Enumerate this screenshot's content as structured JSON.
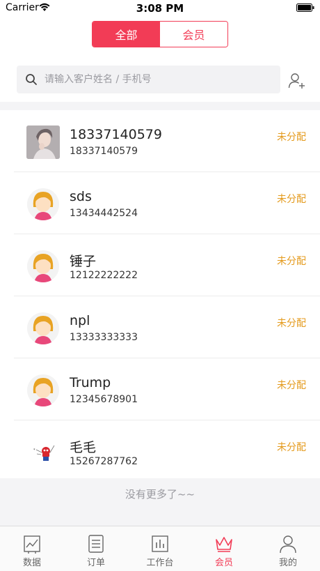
{
  "status_bar": {
    "carrier": "Carrier",
    "time": "3:08 PM"
  },
  "segment": {
    "all_label": "全部",
    "member_label": "会员"
  },
  "search": {
    "placeholder": "请输入客户姓名 / 手机号"
  },
  "customers": [
    {
      "name": "18337140579",
      "phone": "18337140579",
      "status": "未分配",
      "avatar": "photo-avatar"
    },
    {
      "name": "sds",
      "phone": "13434442524",
      "status": "未分配",
      "avatar": "female-avatar"
    },
    {
      "name": "锤子",
      "phone": "12122222222",
      "status": "未分配",
      "avatar": "female-avatar"
    },
    {
      "name": "npl",
      "phone": "13333333333",
      "status": "未分配",
      "avatar": "female-avatar"
    },
    {
      "name": "Trump",
      "phone": "12345678901",
      "status": "未分配",
      "avatar": "female-avatar"
    },
    {
      "name": "毛毛",
      "phone": "15267287762",
      "status": "未分配",
      "avatar": "spiderman-avatar"
    }
  ],
  "list_footer": "没有更多了~~",
  "tabs": [
    {
      "label": "数据",
      "icon": "chart-icon",
      "active": false
    },
    {
      "label": "订单",
      "icon": "order-icon",
      "active": false
    },
    {
      "label": "工作台",
      "icon": "workbench-icon",
      "active": false
    },
    {
      "label": "会员",
      "icon": "crown-icon",
      "active": true
    },
    {
      "label": "我的",
      "icon": "person-icon",
      "active": false
    }
  ],
  "colors": {
    "accent": "#f23c56",
    "status": "#e49a1c"
  }
}
